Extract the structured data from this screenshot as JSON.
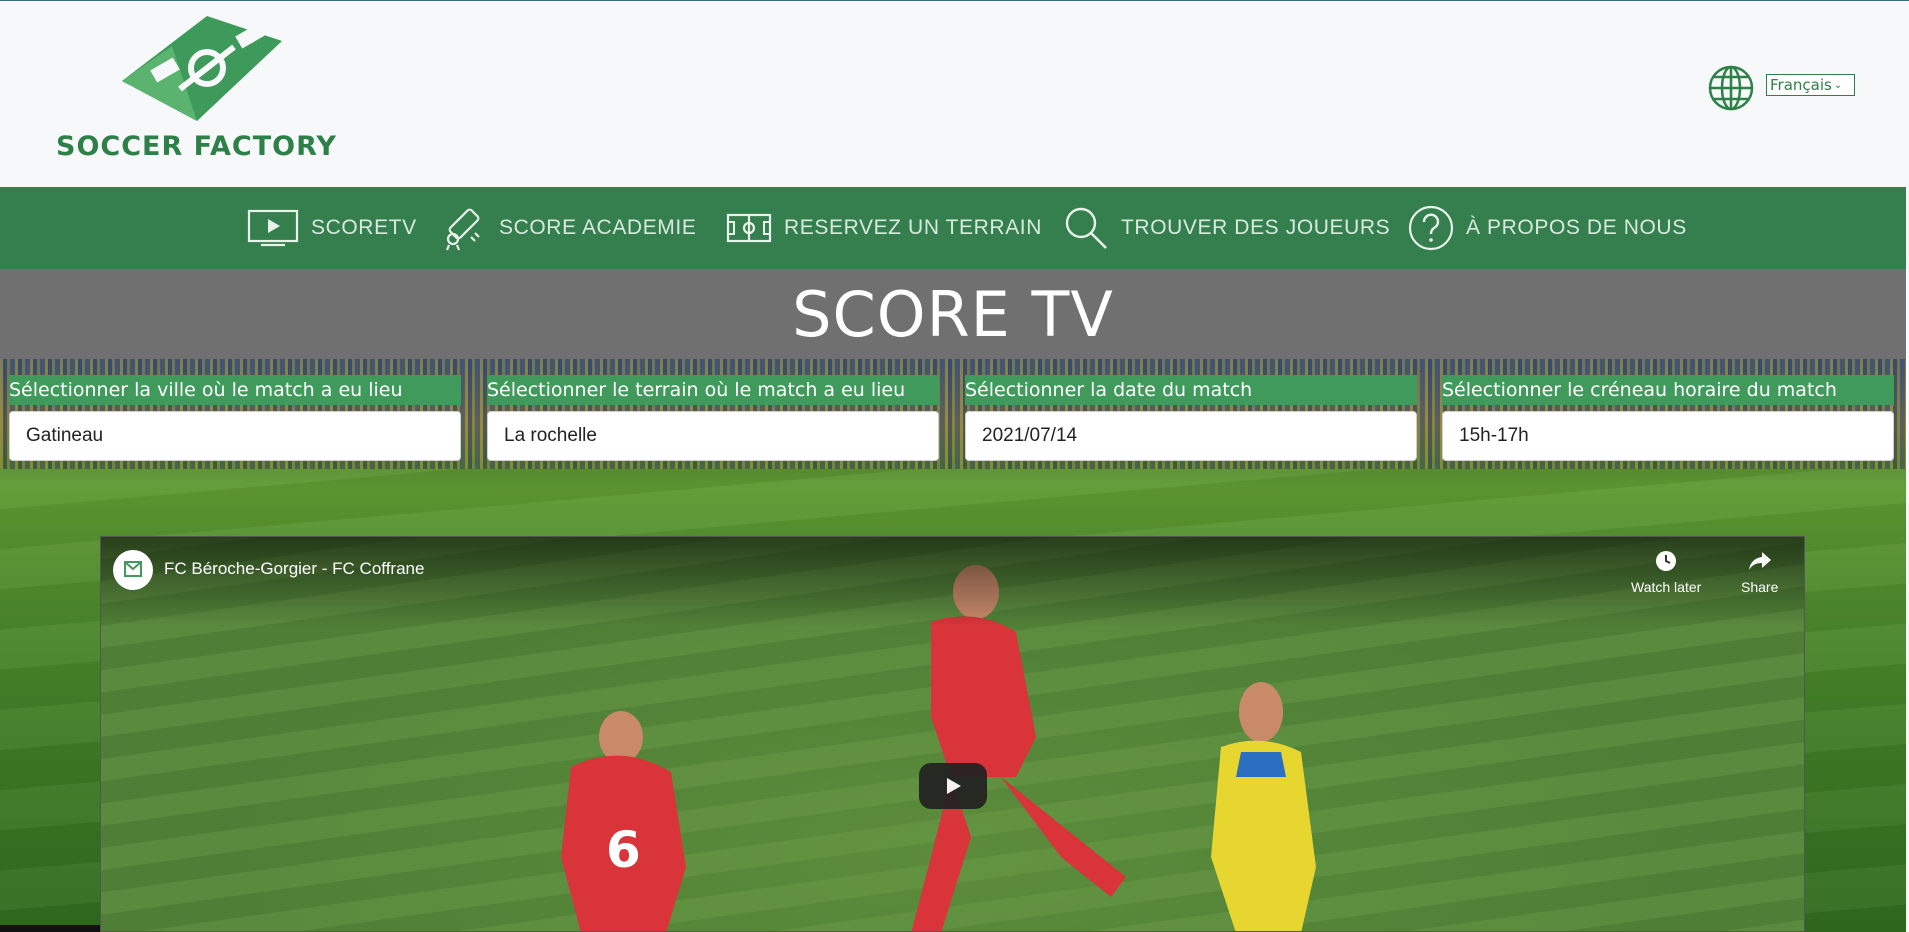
{
  "brand": {
    "name": "SOCCER FACTORY",
    "colors": {
      "primary": "#357f4f",
      "accent": "#3f9a5c",
      "title_bar": "#707070"
    }
  },
  "language": {
    "selected": "Français",
    "icon": "globe-icon"
  },
  "nav": {
    "items": [
      {
        "label": "SCORETV",
        "icon": "tv-play-icon"
      },
      {
        "label": "SCORE ACADEMIE",
        "icon": "diploma-icon"
      },
      {
        "label": "RESERVEZ UN TERRAIN",
        "icon": "field-icon"
      },
      {
        "label": "TROUVER DES JOUEURS",
        "icon": "search-icon"
      },
      {
        "label": "À PROPOS DE NOUS",
        "icon": "question-icon"
      }
    ]
  },
  "page": {
    "title": "SCORE TV"
  },
  "filters": [
    {
      "label": "Sélectionner la ville où le match a eu lieu",
      "value": "Gatineau"
    },
    {
      "label": "Sélectionner le terrain où le match a eu lieu",
      "value": "La rochelle"
    },
    {
      "label": "Sélectionner la date du match",
      "value": "2021/07/14"
    },
    {
      "label": "Sélectionner le créneau horaire du match",
      "value": "15h-17h"
    }
  ],
  "video": {
    "title": "FC Béroche-Gorgier - FC Coffrane",
    "watch_later": "Watch later",
    "share": "Share"
  }
}
